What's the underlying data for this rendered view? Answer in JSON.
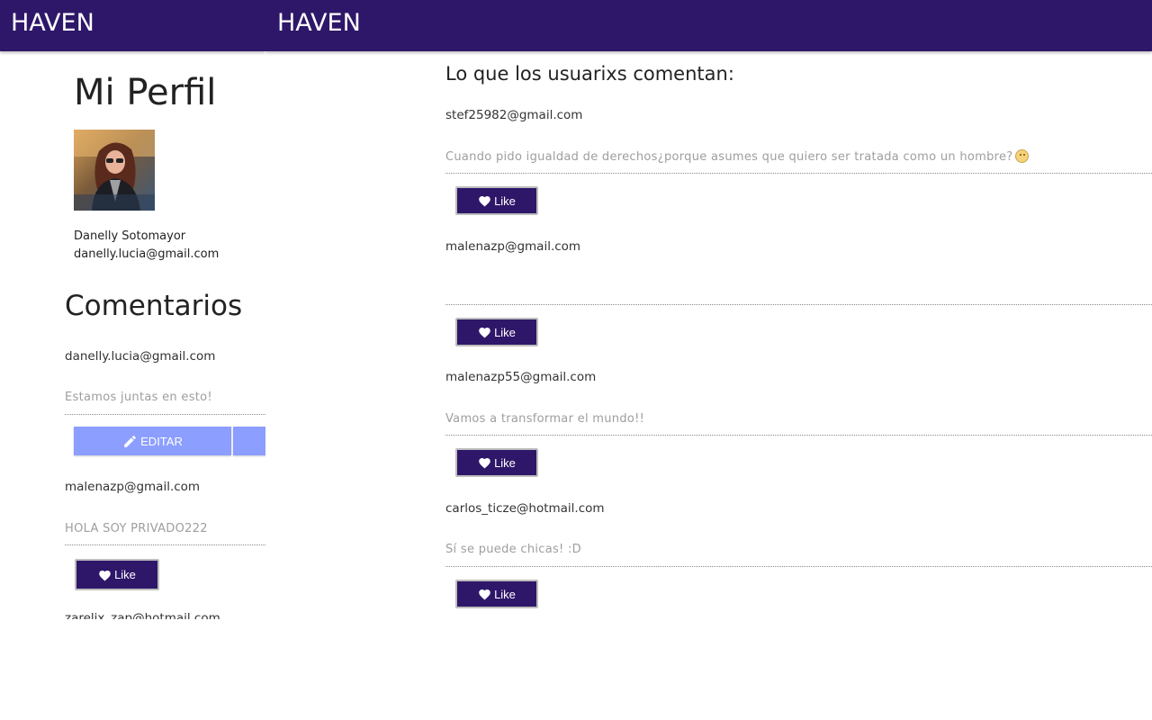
{
  "left_panel": {
    "brand": "HAVEN",
    "profile": {
      "title": "Mi Perfil",
      "name": "Danelly Sotomayor",
      "email": "danelly.lucia@gmail.com"
    },
    "comments": {
      "title": "Comentarios",
      "items": [
        {
          "author": "danelly.lucia@gmail.com",
          "text": "Estamos juntas en esto!",
          "edit_label": "EDITAR"
        },
        {
          "author": "malenazp@gmail.com",
          "text": "HOLA SOY PRIVADO222",
          "like_label": "Like"
        },
        {
          "author": "zarelix_zap@hotmail.com"
        }
      ]
    }
  },
  "right_panel": {
    "brand": "HAVEN",
    "feed_title": "Lo que los usuarixs comentan:",
    "posts": [
      {
        "author": "stef25982@gmail.com",
        "text": "Cuando pido igualdad de derechos¿porque asumes que quiero ser tratada como un hombre?",
        "emoji": "neutral-face-emoji",
        "like_label": "Like"
      },
      {
        "author": "malenazp@gmail.com",
        "text": "",
        "like_label": "Like"
      },
      {
        "author": "malenazp55@gmail.com",
        "text": "Vamos a transformar el mundo!!",
        "like_label": "Like"
      },
      {
        "author": "carlos_ticze@hotmail.com",
        "text": "Sí se puede chicas! :D",
        "like_label": "Like"
      }
    ]
  },
  "colors": {
    "header_bg": "#2e1769",
    "like_button_bg": "#2e1769",
    "edit_button_bg": "#8c9eff",
    "muted_text": "#9e9e9e"
  }
}
